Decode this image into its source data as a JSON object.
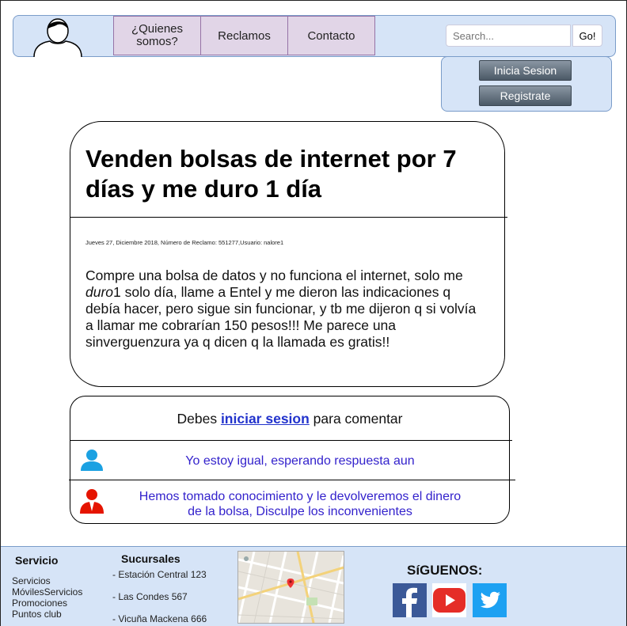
{
  "nav": {
    "items": [
      {
        "label": "¿Quienes\nsomos?"
      },
      {
        "label": "Reclamos"
      },
      {
        "label": "Contacto"
      }
    ],
    "search_placeholder": "Search...",
    "search_go": "Go!"
  },
  "auth": {
    "login_label": "Inicia Sesion",
    "register_label": "Registrate"
  },
  "post": {
    "title": "Venden bolsas de internet por 7 días y me duro 1 día",
    "meta": "Jueves 27, Diciembre 2018, Número de Reclamo: 551277,Usuario: nalore1",
    "body_part1": "Compre una bolsa de datos y no funciona el internet, solo me ",
    "body_italic": "duro",
    "body_part2": "1 solo día, llame a Entel y me dieron las indicaciones q debía hacer, pero sigue sin funcionar, y tb me dijeron q si volvía a llamar me cobrarían 150 pesos!!! Me parece una sinverguenzura ya q dicen q la llamada es gratis!!"
  },
  "comments": {
    "prompt_prefix": "Debes ",
    "prompt_link": "iniciar sesion",
    "prompt_suffix": " para comentar",
    "items": [
      {
        "text": "Yo estoy igual, esperando respuesta aun",
        "icon": "user-icon",
        "color": "#1ba1e2"
      },
      {
        "text": "Hemos tomado conocimiento y le devolveremos el dinero de la bolsa, Disculpe los inconvenientes",
        "icon": "staff-icon",
        "color": "#e51400"
      }
    ]
  },
  "footer": {
    "servicio": {
      "heading": "Servicio",
      "lines": [
        "Servicios",
        "MóvilesServicios",
        "Promociones",
        "Puntos club"
      ]
    },
    "sucursales": {
      "heading": "Sucursales",
      "lines": [
        "- Estación Central 123",
        "- Las Condes 567",
        "- Vicuña Mackena 666"
      ]
    },
    "siguenos": "SíGUENOS:",
    "social": [
      {
        "name": "facebook-icon",
        "color": "#3b5998"
      },
      {
        "name": "youtube-icon",
        "color": "#e52d27"
      },
      {
        "name": "twitter-icon",
        "color": "#1da1f2"
      }
    ]
  }
}
